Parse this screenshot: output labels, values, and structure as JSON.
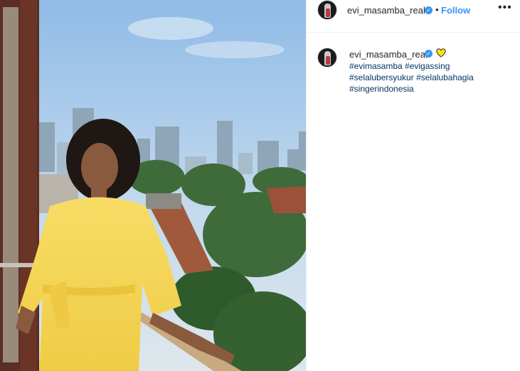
{
  "header": {
    "username": "evi_masamba_real",
    "dot": "•",
    "follow_label": "Follow",
    "more_icon": "•••"
  },
  "caption": {
    "username": "evi_masamba_real",
    "hashtags": [
      "#evimasamba",
      "#evigassing",
      "#selalubersyukur",
      "#selalubahagia",
      "#singerindonesia"
    ]
  },
  "colors": {
    "accent": "#3897f0",
    "hashtag": "#003569",
    "heart_fill": "#ffe11a",
    "heart_stroke": "#2b2b2b",
    "dress": "#f5d65a"
  },
  "icons": {
    "verified": "verified-badge-icon",
    "heart": "yellow-heart-icon",
    "more": "more-options-icon"
  }
}
